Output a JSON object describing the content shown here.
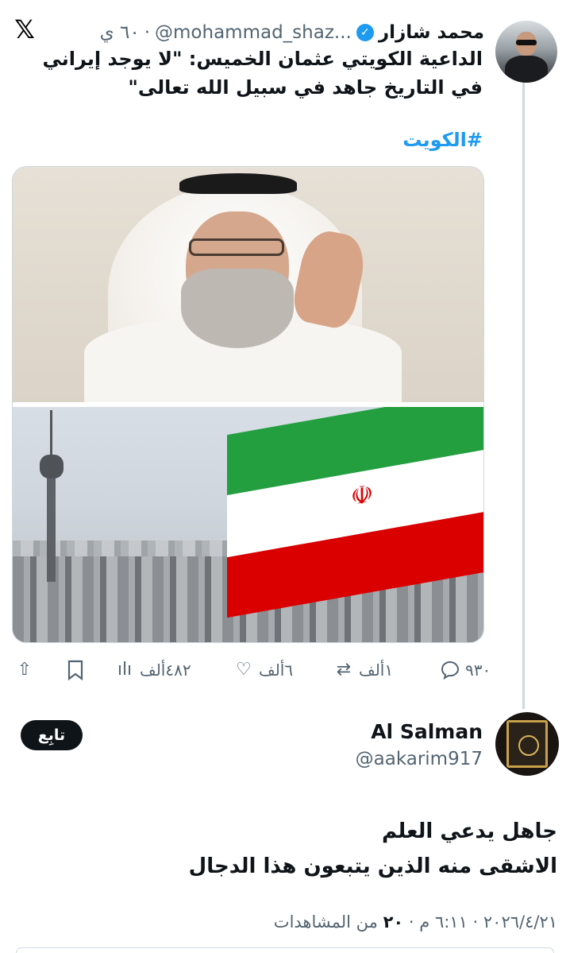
{
  "app": {
    "logo": "𝕏"
  },
  "post": {
    "author_name": "محمد شازار",
    "author_handle": "@mohammad_shaz...",
    "separator": "·",
    "time": "٦٠ ي",
    "text": "الداعية الكويتي عثمان الخميس: \"لا يوجد إيراني في التاريخ جاهد في سبيل الله تعالى\"",
    "hashtag": "#الكويت",
    "media_alt": [
      "صورة الشيخ عثمان الخميس",
      "علم إيران وبرج ميلاد"
    ],
    "emblem": "☫"
  },
  "actions": {
    "reply_count": "٩٣٠",
    "repost_count": "١ألف",
    "like_count": "٦ألف",
    "views_count": "٤٨٢ألف",
    "icons": {
      "reply": "comment-icon",
      "repost": "repost-icon",
      "like": "heart-icon",
      "views": "views-icon",
      "bookmark": "bookmark-icon",
      "share": "share-icon"
    }
  },
  "reply": {
    "author_name": "Al Salman",
    "author_handle": "@aakarim917",
    "follow_label": "تابِع",
    "line1": "جاهل يدعي العلم",
    "line2": "الاشقى منه الذين يتبعون هذا الدجال",
    "date_time": "٢٠٢٦/٤/٢١ · ٦:١١ م · ",
    "views": "٢٠",
    "views_suffix": " من المشاهدات"
  },
  "colors": {
    "accent": "#1d9bf0",
    "text": "#0f1419",
    "muted": "#536471",
    "border": "#cfd9de"
  }
}
